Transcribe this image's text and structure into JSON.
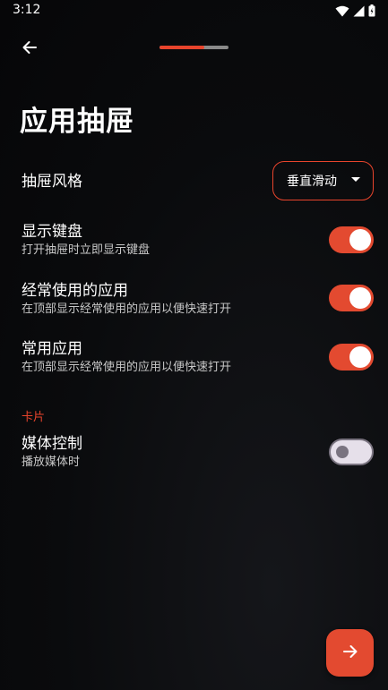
{
  "status_bar": {
    "time": "3:12",
    "icons": [
      "wifi-icon",
      "signal-icon",
      "battery-icon"
    ]
  },
  "header": {
    "back_icon": "arrow-left-icon",
    "progress_fraction": 0.65
  },
  "page": {
    "title": "应用抽屉"
  },
  "settings": {
    "drawer_style": {
      "title": "抽屉风格",
      "selected_value": "垂直滑动"
    },
    "show_keyboard": {
      "title": "显示键盘",
      "subtitle": "打开抽屉时立即显示键盘",
      "enabled": true
    },
    "frequent_apps": {
      "title": "经常使用的应用",
      "subtitle": "在顶部显示经常使用的应用以便快速打开",
      "enabled": true
    },
    "common_apps": {
      "title": "常用应用",
      "subtitle": "在顶部显示经常使用的应用以便快速打开",
      "enabled": true
    }
  },
  "cards_section": {
    "header": "卡片",
    "media_control": {
      "title": "媒体控制",
      "subtitle": "播放媒体时",
      "enabled": false
    }
  },
  "fab": {
    "icon": "arrow-right-icon"
  },
  "colors": {
    "accent": "#e8442c",
    "background": "#0a0b0d",
    "toggle_off_track": "#e6e0ea"
  }
}
